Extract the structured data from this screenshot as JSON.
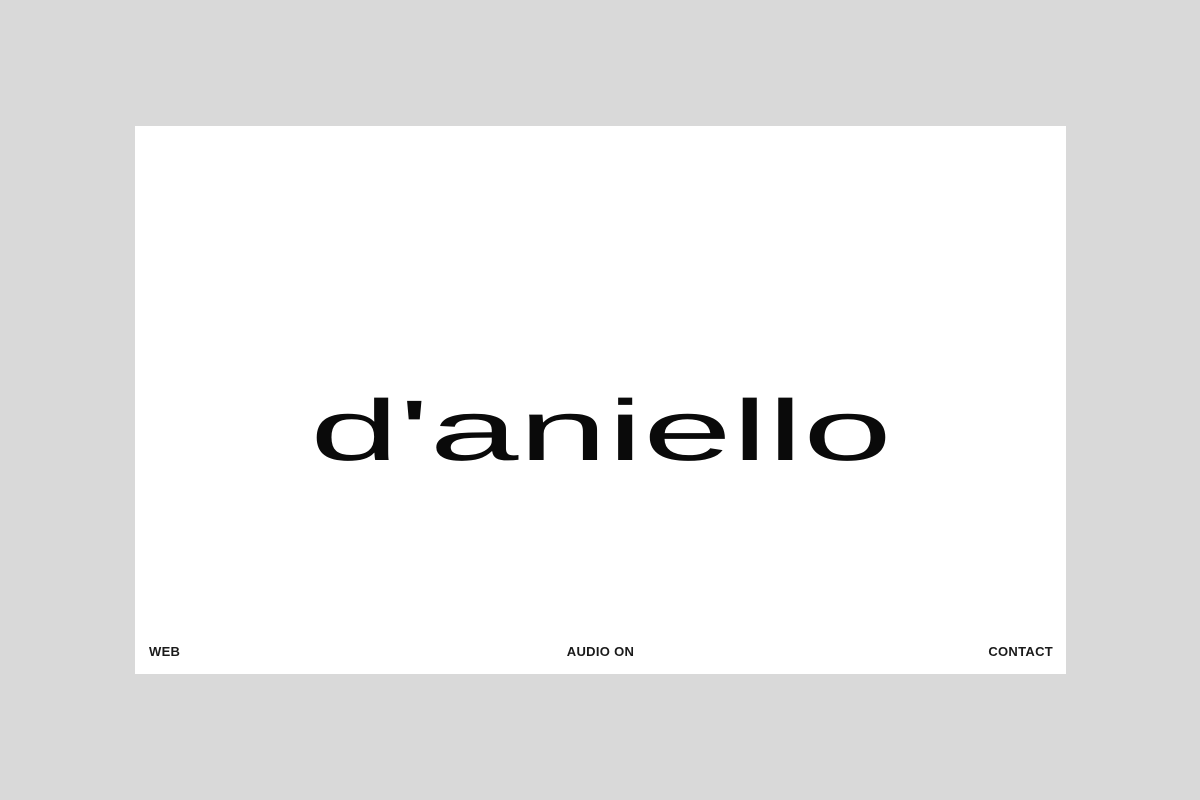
{
  "logo": {
    "text": "d'aniello",
    "color": "#0a0a0a"
  },
  "nav": {
    "left_label": "WEB",
    "center_label": "AUDIO ON",
    "right_label": "CONTACT"
  },
  "colors": {
    "page_background": "#d9d9d9",
    "frame_background": "#ffffff",
    "text": "#1a1a1a"
  }
}
